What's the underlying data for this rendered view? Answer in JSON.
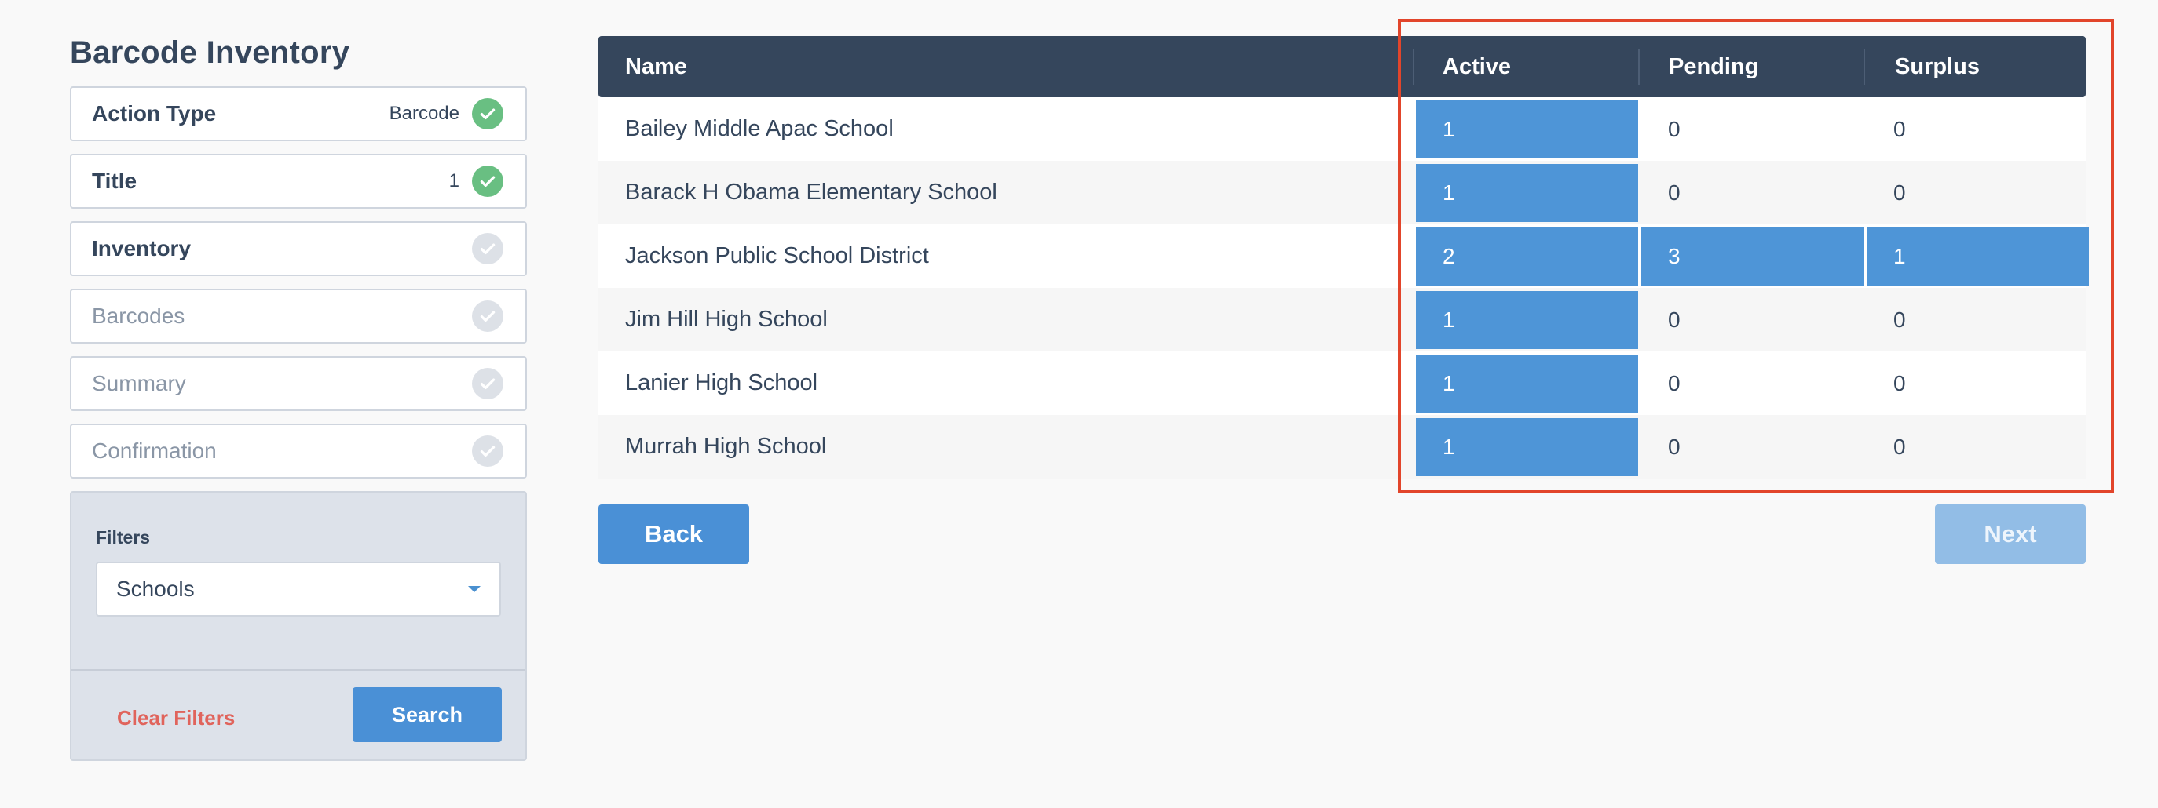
{
  "page_title": "Barcode Inventory",
  "steps": [
    {
      "label": "Action Type",
      "value": "Barcode",
      "status": "complete"
    },
    {
      "label": "Title",
      "value": "1",
      "status": "complete"
    },
    {
      "label": "Inventory",
      "value": "",
      "status": "current"
    },
    {
      "label": "Barcodes",
      "value": "",
      "status": "pending"
    },
    {
      "label": "Summary",
      "value": "",
      "status": "pending"
    },
    {
      "label": "Confirmation",
      "value": "",
      "status": "pending"
    }
  ],
  "filters": {
    "label": "Filters",
    "selected": "Schools",
    "clear_label": "Clear Filters",
    "search_label": "Search"
  },
  "table": {
    "headers": {
      "name": "Name",
      "active": "Active",
      "pending": "Pending",
      "surplus": "Surplus"
    },
    "rows": [
      {
        "name": "Bailey Middle Apac School",
        "active": "1",
        "pending": "0",
        "surplus": "0"
      },
      {
        "name": "Barack H Obama Elementary School",
        "active": "1",
        "pending": "0",
        "surplus": "0"
      },
      {
        "name": "Jackson Public School District",
        "active": "2",
        "pending": "3",
        "surplus": "1"
      },
      {
        "name": "Jim Hill High School",
        "active": "1",
        "pending": "0",
        "surplus": "0"
      },
      {
        "name": "Lanier High School",
        "active": "1",
        "pending": "0",
        "surplus": "0"
      },
      {
        "name": "Murrah High School",
        "active": "1",
        "pending": "0",
        "surplus": "0"
      }
    ]
  },
  "buttons": {
    "back": "Back",
    "next": "Next"
  },
  "colors": {
    "header_bg": "#35465c",
    "primary": "#4a90d6",
    "highlight_cell": "#4e95d7",
    "complete_check": "#69bf82",
    "annotation_frame": "#e2452b",
    "clear_filters": "#e0645c"
  }
}
